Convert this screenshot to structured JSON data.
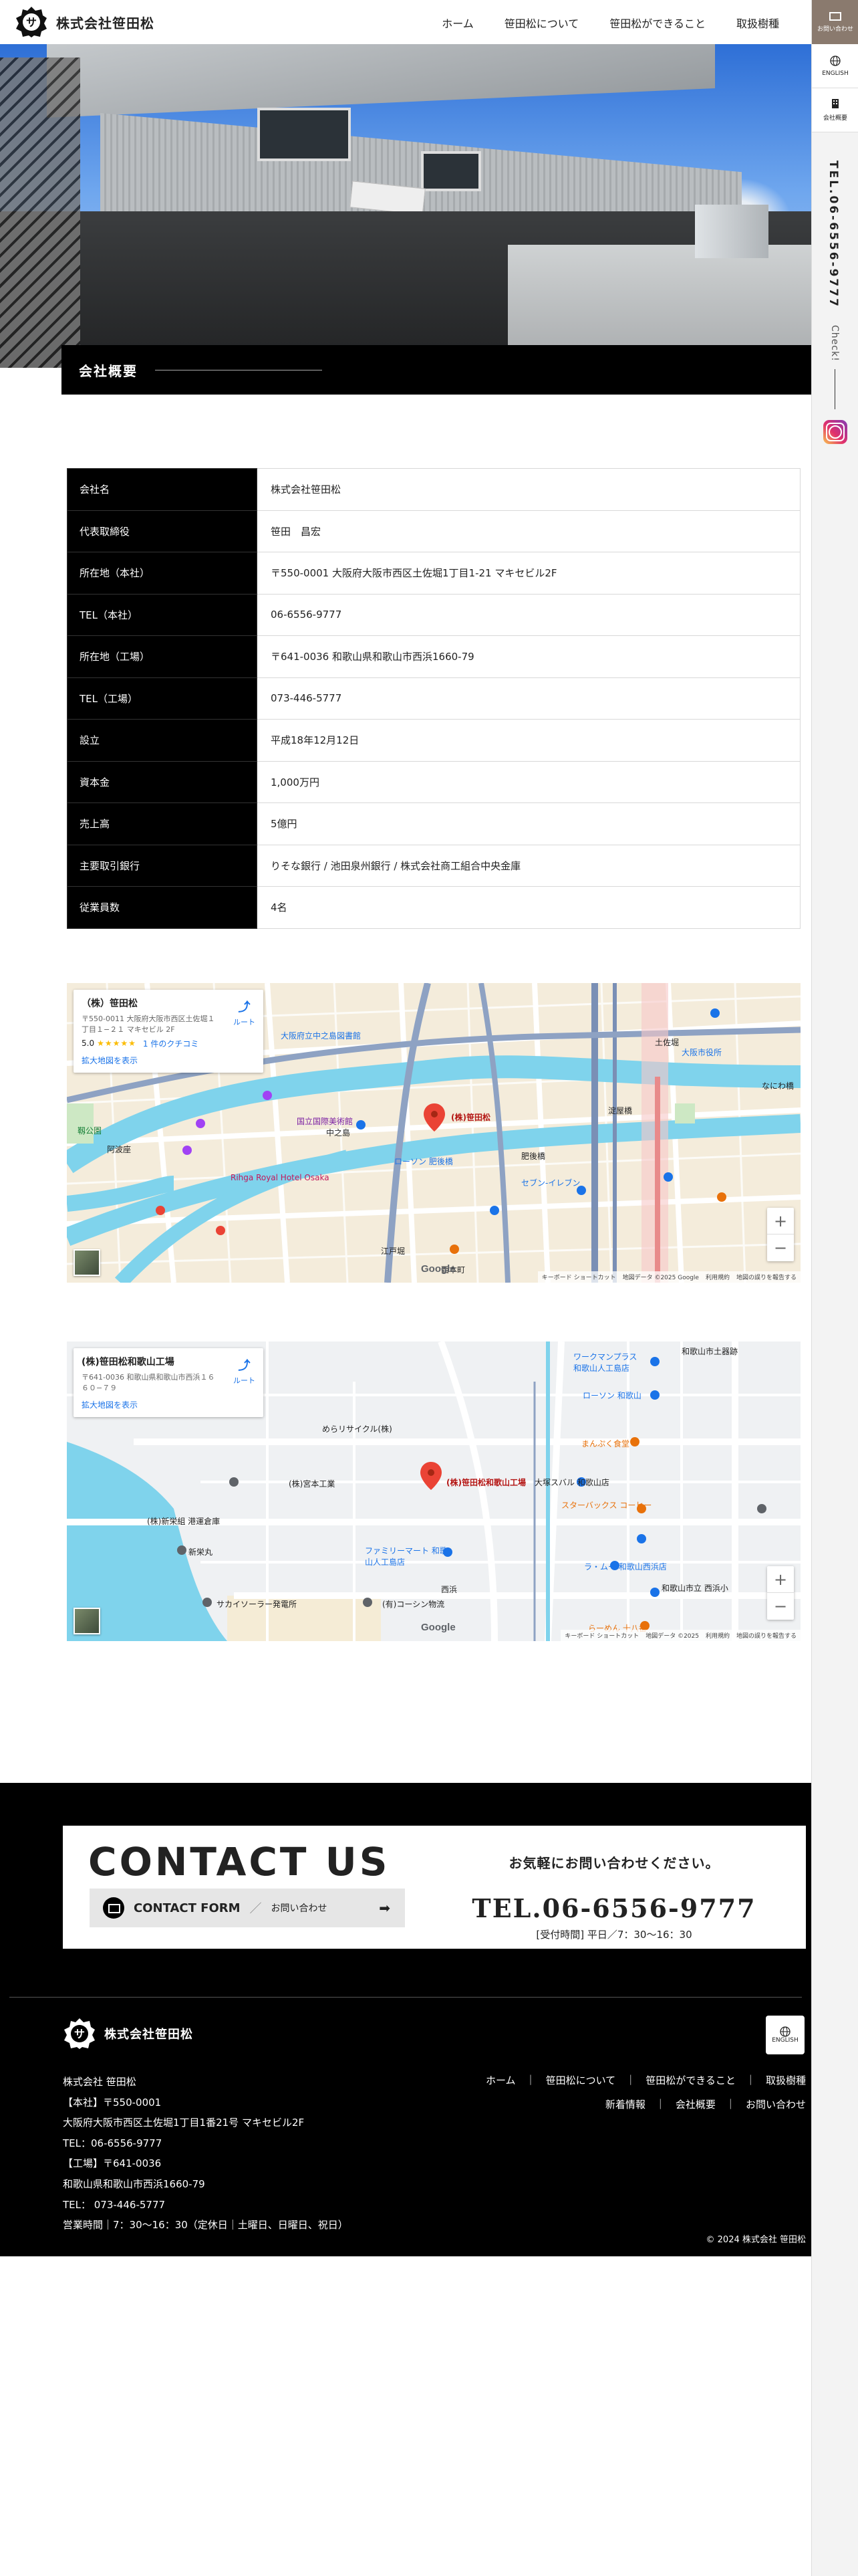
{
  "brand": {
    "name": "株式会社笹田松",
    "mark": "サ"
  },
  "nav": [
    "ホーム",
    "笹田松について",
    "笹田松ができること",
    "取扱樹種"
  ],
  "side": {
    "contact_label": "お問い合わせ",
    "english_label": "ENGLISH",
    "company_label": "会社概要",
    "tel": "TEL.06-6556-9777",
    "check": "Check!"
  },
  "hero": {
    "title": "会社概要"
  },
  "company_rows": [
    {
      "k": "会社名",
      "v": "株式会社笹田松"
    },
    {
      "k": "代表取締役",
      "v": "笹田　昌宏"
    },
    {
      "k": "所在地（本社）",
      "v": "〒550-0001 大阪府大阪市西区土佐堀1丁目1-21 マキセビル2F"
    },
    {
      "k": "TEL（本社）",
      "v": "06-6556-9777"
    },
    {
      "k": "所在地（工場）",
      "v": "〒641-0036 和歌山県和歌山市西浜1660-79"
    },
    {
      "k": "TEL（工場）",
      "v": "073-446-5777"
    },
    {
      "k": "設立",
      "v": "平成18年12月12日"
    },
    {
      "k": "資本金",
      "v": "1,000万円"
    },
    {
      "k": "売上高",
      "v": "5億円"
    },
    {
      "k": "主要取引銀行",
      "v": "りそな銀行 / 池田泉州銀行 / 株式会社商工組合中央金庫"
    },
    {
      "k": "従業員数",
      "v": "4名"
    }
  ],
  "map1": {
    "title": "（株）笹田松",
    "address": "〒550-0011 大阪府大阪市西区土佐堀１丁目１−２１ マキセビル 2F",
    "rating": "5.0",
    "stars": "★★★★★",
    "reviews": "1 件のクチコミ",
    "enlarge": "拡大地図を表示",
    "route": "ルート",
    "pin": "(株)笹田松",
    "labels": [
      "国立国際美術館",
      "中之島",
      "Rihga Royal Hotel Osaka",
      "ローソン 肥後橋",
      "セブン-イレブン",
      "肥後橋",
      "淀屋橋",
      "大阪府立中之島図書館",
      "江戸堀",
      "土佐堀",
      "大阪市役所",
      "なにわ橋",
      "西本町",
      "靱公園",
      "阿波座"
    ],
    "footer": [
      "キーボード ショートカット",
      "地図データ ©2025 Google",
      "利用規約",
      "地図の誤りを報告する"
    ]
  },
  "map2": {
    "title": "(株)笹田松和歌山工場",
    "address": "〒641-0036 和歌山県和歌山市西浜１６６０−７９",
    "enlarge": "拡大地図を表示",
    "route": "ルート",
    "pin": "(株)笹田松和歌山工場",
    "labels": [
      "ワークマンプラス 和歌山人工島店",
      "ローソン 和歌山",
      "めらリサイクル(株)",
      "(株)宮本工業",
      "大塚スバル 和歌山店",
      "スターバックス コーヒー",
      "ファミリーマート 和歌山人工島店",
      "(有)コーシン物流",
      "ラ・ムー 和歌山西浜店",
      "まんぷく食堂",
      "(株)新栄組 港運倉庫",
      "新栄丸",
      "西浜",
      "和歌山市立 西浜小",
      "らーめん 十八番",
      "サカイソーラー発電所",
      "和歌山市土器跡"
    ],
    "footer": [
      "キーボード ショートカット",
      "地図データ ©2025",
      "利用規約",
      "地図の誤りを報告する"
    ]
  },
  "contact": {
    "heading": "CONTACT US",
    "form_label": "CONTACT FORM",
    "form_sep": "／",
    "form_sub": "お問い合わせ",
    "arrow": "➡",
    "question": "お気軽にお問い合わせください。",
    "tel": "TEL.06-6556-9777",
    "hours": "[受付時間] 平日／7：30〜16：30"
  },
  "footer": {
    "info": [
      "株式会社 笹田松",
      "【本社】〒550-0001",
      "大阪府大阪市西区土佐堀1丁目1番21号 マキセビル2F",
      "TEL：06-6556-9777",
      "【工場】〒641-0036",
      "和歌山県和歌山市西浜1660-79",
      "TEL： 073-446-5777",
      "営業時間｜7：30〜16：30（定休日｜土曜日、日曜日、祝日）"
    ],
    "nav1": [
      "ホーム",
      "笹田松について",
      "笹田松ができること",
      "取扱樹種"
    ],
    "nav2": [
      "新着情報",
      "会社概要",
      "お問い合わせ"
    ],
    "english": "ENGLISH",
    "copyright": "© 2024 株式会社 笹田松"
  },
  "colors": {
    "accent": "#8a7a6e",
    "black": "#000000",
    "map_water": "#7fd3ec",
    "map_road": "#ffffff",
    "pin": "#ea4335"
  }
}
